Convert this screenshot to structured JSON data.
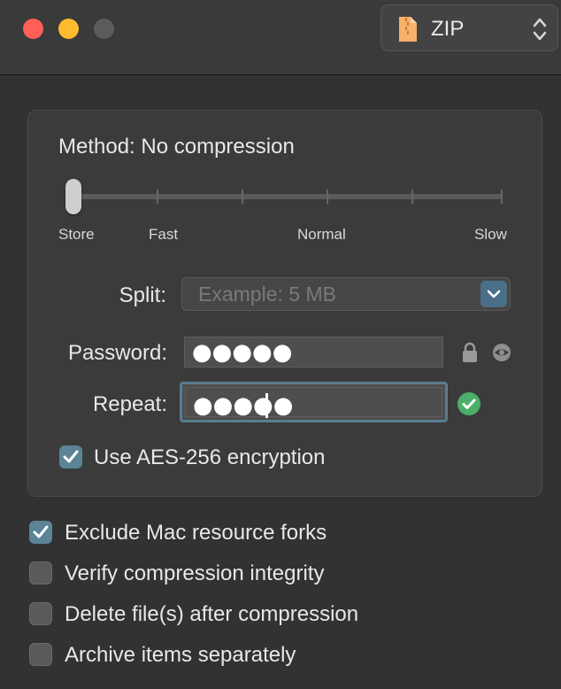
{
  "window": {
    "traffic_lights": [
      "close",
      "minimize",
      "zoom"
    ]
  },
  "format": {
    "selected": "ZIP",
    "icon": "document-icon"
  },
  "method": {
    "label": "Method: No compression",
    "slider_value": "Store",
    "slider_fraction": 0.0,
    "ticks": [
      "Store",
      "Fast",
      "Normal",
      "Slow"
    ]
  },
  "split": {
    "label": "Split:",
    "placeholder": "Example: 5 MB"
  },
  "password": {
    "label": "Password:",
    "value": "●●●●●"
  },
  "repeat": {
    "label": "Repeat:",
    "value": "●●●●●",
    "match": true
  },
  "encryption": {
    "label": "Use AES-256 encryption",
    "checked": true
  },
  "options": [
    {
      "label": "Exclude Mac resource forks",
      "checked": true
    },
    {
      "label": "Verify compression integrity",
      "checked": false
    },
    {
      "label": "Delete file(s) after compression",
      "checked": false
    },
    {
      "label": "Archive items separately",
      "checked": false
    }
  ],
  "colors": {
    "accent": "#5b8496",
    "success": "#4caf6a",
    "close": "#ff5f57",
    "minimize": "#febc2e"
  }
}
